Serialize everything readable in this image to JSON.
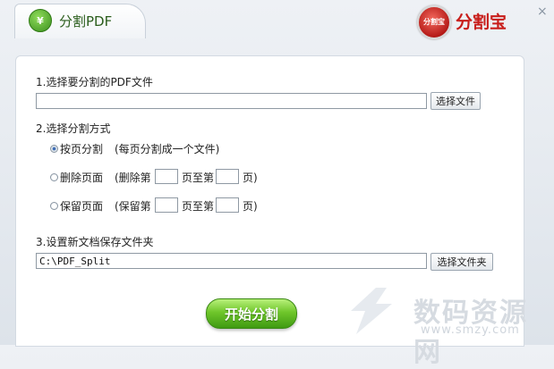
{
  "tab": {
    "title": "分割PDF",
    "logo_letter": "¥"
  },
  "brand": {
    "seal_text": "分割宝",
    "name": "分割宝"
  },
  "close_glyph": "×",
  "section1": {
    "label": "1.选择要分割的PDF文件",
    "file_value": "",
    "browse_button": "选择文件"
  },
  "section2": {
    "label": "2.选择分割方式",
    "options": [
      {
        "label": "按页分割",
        "desc": "(每页分割成一个文件)",
        "checked": true
      },
      {
        "label": "删除页面",
        "desc_prefix": "(删除第",
        "mid": "页至第",
        "suffix": "页)",
        "checked": false
      },
      {
        "label": "保留页面",
        "desc_prefix": "(保留第",
        "mid": "页至第",
        "suffix": "页)",
        "checked": false
      }
    ]
  },
  "section3": {
    "label": "3.设置新文档保存文件夹",
    "folder_value": "C:\\PDF_Split",
    "browse_button": "选择文件夹"
  },
  "start_button": "开始分割",
  "watermark": {
    "text": "数码资源网",
    "url": "www.smzy.com"
  },
  "colors": {
    "accent_green": "#6fc62b",
    "brand_red": "#c81d1a",
    "radio_blue": "#3d6cb5"
  }
}
